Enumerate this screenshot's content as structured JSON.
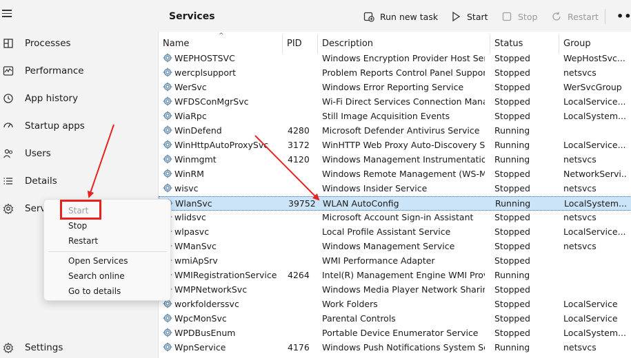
{
  "sidebar": {
    "items": [
      {
        "label": "Processes",
        "icon": "processes-icon"
      },
      {
        "label": "Performance",
        "icon": "performance-icon"
      },
      {
        "label": "App history",
        "icon": "app-history-icon"
      },
      {
        "label": "Startup apps",
        "icon": "startup-apps-icon"
      },
      {
        "label": "Users",
        "icon": "users-icon"
      },
      {
        "label": "Details",
        "icon": "details-icon"
      },
      {
        "label": "Serv",
        "icon": "services-icon"
      }
    ],
    "settings_label": "Settings"
  },
  "header": {
    "title": "Services",
    "run_new_task": "Run new task",
    "start": "Start",
    "stop": "Stop",
    "restart": "Restart",
    "more": "•••"
  },
  "table": {
    "columns": [
      "Name",
      "PID",
      "Description",
      "Status",
      "Group"
    ],
    "sort_indicator": "^",
    "rows": [
      {
        "name": "WEPHOSTSVC",
        "pid": "",
        "description": "Windows Encryption Provider Host Ser...",
        "status": "Stopped",
        "group": "WepHostSvc..."
      },
      {
        "name": "wercplsupport",
        "pid": "",
        "description": "Problem Reports Control Panel Support",
        "status": "Stopped",
        "group": "netsvcs"
      },
      {
        "name": "WerSvc",
        "pid": "",
        "description": "Windows Error Reporting Service",
        "status": "Stopped",
        "group": "WerSvcGroup"
      },
      {
        "name": "WFDSConMgrSvc",
        "pid": "",
        "description": "Wi-Fi Direct Services Connection Mana...",
        "status": "Stopped",
        "group": "LocalService..."
      },
      {
        "name": "WiaRpc",
        "pid": "",
        "description": "Still Image Acquisition Events",
        "status": "Stopped",
        "group": "LocalSystem..."
      },
      {
        "name": "WinDefend",
        "pid": "4280",
        "description": "Microsoft Defender Antivirus Service",
        "status": "Running",
        "group": ""
      },
      {
        "name": "WinHttpAutoProxySvc",
        "pid": "3172",
        "description": "WinHTTP Web Proxy Auto-Discovery S...",
        "status": "Running",
        "group": "LocalService..."
      },
      {
        "name": "Winmgmt",
        "pid": "4120",
        "description": "Windows Management Instrumentation",
        "status": "Running",
        "group": "netsvcs"
      },
      {
        "name": "WinRM",
        "pid": "",
        "description": "Windows Remote Management (WS-M...",
        "status": "Stopped",
        "group": "NetworkServi..."
      },
      {
        "name": "wisvc",
        "pid": "",
        "description": "Windows Insider Service",
        "status": "Stopped",
        "group": "netsvcs"
      },
      {
        "name": "WlanSvc",
        "pid": "39752",
        "description": "WLAN AutoConfig",
        "status": "Running",
        "group": "LocalSystem..."
      },
      {
        "name": "wlidsvc",
        "pid": "",
        "description": "Microsoft Account Sign-in Assistant",
        "status": "Stopped",
        "group": "netsvcs"
      },
      {
        "name": "wlpasvc",
        "pid": "",
        "description": "Local Profile Assistant Service",
        "status": "Stopped",
        "group": "LocalService..."
      },
      {
        "name": "WManSvc",
        "pid": "",
        "description": "Windows Management Service",
        "status": "Stopped",
        "group": "netsvcs"
      },
      {
        "name": "wmiApSrv",
        "pid": "",
        "description": "WMI Performance Adapter",
        "status": "Stopped",
        "group": ""
      },
      {
        "name": "WMIRegistrationService",
        "pid": "4264",
        "description": "Intel(R) Management Engine WMI Prov...",
        "status": "Running",
        "group": ""
      },
      {
        "name": "WMPNetworkSvc",
        "pid": "",
        "description": "Windows Media Player Network Sharin...",
        "status": "Stopped",
        "group": ""
      },
      {
        "name": "workfolderssvc",
        "pid": "",
        "description": "Work Folders",
        "status": "Stopped",
        "group": "LocalService"
      },
      {
        "name": "WpcMonSvc",
        "pid": "",
        "description": "Parental Controls",
        "status": "Stopped",
        "group": "LocalService"
      },
      {
        "name": "WPDBusEnum",
        "pid": "",
        "description": "Portable Device Enumerator Service",
        "status": "Stopped",
        "group": "LocalSystem..."
      },
      {
        "name": "WpnService",
        "pid": "4176",
        "description": "Windows Push Notifications System Se...",
        "status": "Running",
        "group": "netsvcs"
      }
    ],
    "selected_index": 10
  },
  "context_menu": {
    "items": [
      "Start",
      "Stop",
      "Restart",
      "Open Services",
      "Search online",
      "Go to details"
    ],
    "disabled": [
      "Start"
    ]
  },
  "colors": {
    "highlight_box": "#e8231f",
    "arrow": "#e8231f",
    "selected_row": "#cce4f7",
    "sidebar_bg": "#f3f3f3"
  }
}
